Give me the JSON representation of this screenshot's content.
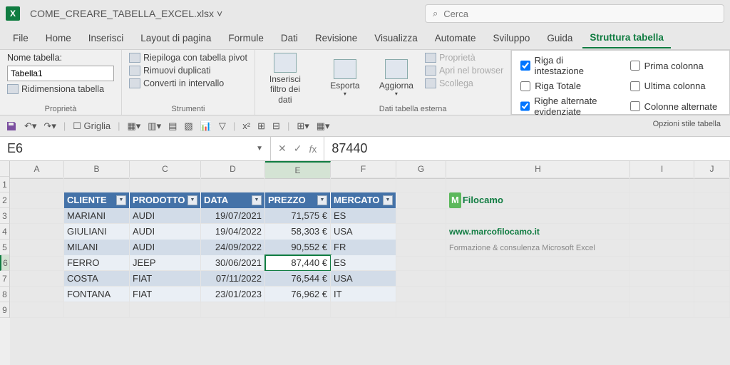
{
  "titlebar": {
    "filename": "COME_CREARE_TABELLA_EXCEL.xlsx ˅",
    "search_placeholder": "Cerca"
  },
  "tabs": [
    "File",
    "Home",
    "Inserisci",
    "Layout di pagina",
    "Formule",
    "Dati",
    "Revisione",
    "Visualizza",
    "Automate",
    "Sviluppo",
    "Guida",
    "Struttura tabella"
  ],
  "active_tab": 11,
  "ribbon": {
    "props": {
      "label": "Nome tabella:",
      "value": "Tabella1",
      "resize": "Ridimensiona tabella",
      "group": "Proprietà"
    },
    "tools": {
      "pivot": "Riepiloga con tabella pivot",
      "dup": "Rimuovi duplicati",
      "conv": "Converti in intervallo",
      "group": "Strumenti"
    },
    "slicer": {
      "label": "Inserisci filtro dei dati"
    },
    "export": {
      "label": "Esporta"
    },
    "refresh": {
      "label": "Aggiorna"
    },
    "ext": {
      "prop": "Proprietà",
      "open": "Apri nel browser",
      "unlink": "Scollega",
      "group": "Dati tabella esterna"
    },
    "opts": {
      "header_row": "Riga di intestazione",
      "total_row": "Riga Totale",
      "banded_rows": "Righe alternate evidenziate",
      "first_col": "Prima colonna",
      "last_col": "Ultima colonna",
      "banded_cols": "Colonne alternate",
      "group": "Opzioni stile tabella"
    }
  },
  "qat": {
    "grid": "Griglia"
  },
  "formula": {
    "ref": "E6",
    "value": "87440"
  },
  "columns": [
    "A",
    "B",
    "C",
    "D",
    "E",
    "F",
    "G",
    "H",
    "I",
    "J"
  ],
  "sel_col_idx": 4,
  "rows": [
    "",
    "1",
    "2",
    "3",
    "4",
    "5",
    "6",
    "7",
    "8",
    "9"
  ],
  "sel_row_idx": 6,
  "table": {
    "headers": [
      "CLIENTE",
      "PRODOTTO",
      "DATA",
      "PREZZO",
      "MERCATO"
    ],
    "data": [
      [
        "MARIANI",
        "AUDI",
        "19/07/2021",
        "71,575 €",
        "ES"
      ],
      [
        "GIULIANI",
        "AUDI",
        "19/04/2022",
        "58,303 €",
        "USA"
      ],
      [
        "MILANI",
        "AUDI",
        "24/09/2022",
        "90,552 €",
        "FR"
      ],
      [
        "FERRO",
        "JEEP",
        "30/06/2021",
        "87,440 €",
        "ES"
      ],
      [
        "COSTA",
        "FIAT",
        "07/11/2022",
        "76,544 €",
        "USA"
      ],
      [
        "FONTANA",
        "FIAT",
        "23/01/2023",
        "76,962 €",
        "IT"
      ]
    ]
  },
  "branding": {
    "name": "Filocamo",
    "url": "www.marcofilocamo.it",
    "tag": "Formazione & consulenza Microsoft Excel"
  }
}
